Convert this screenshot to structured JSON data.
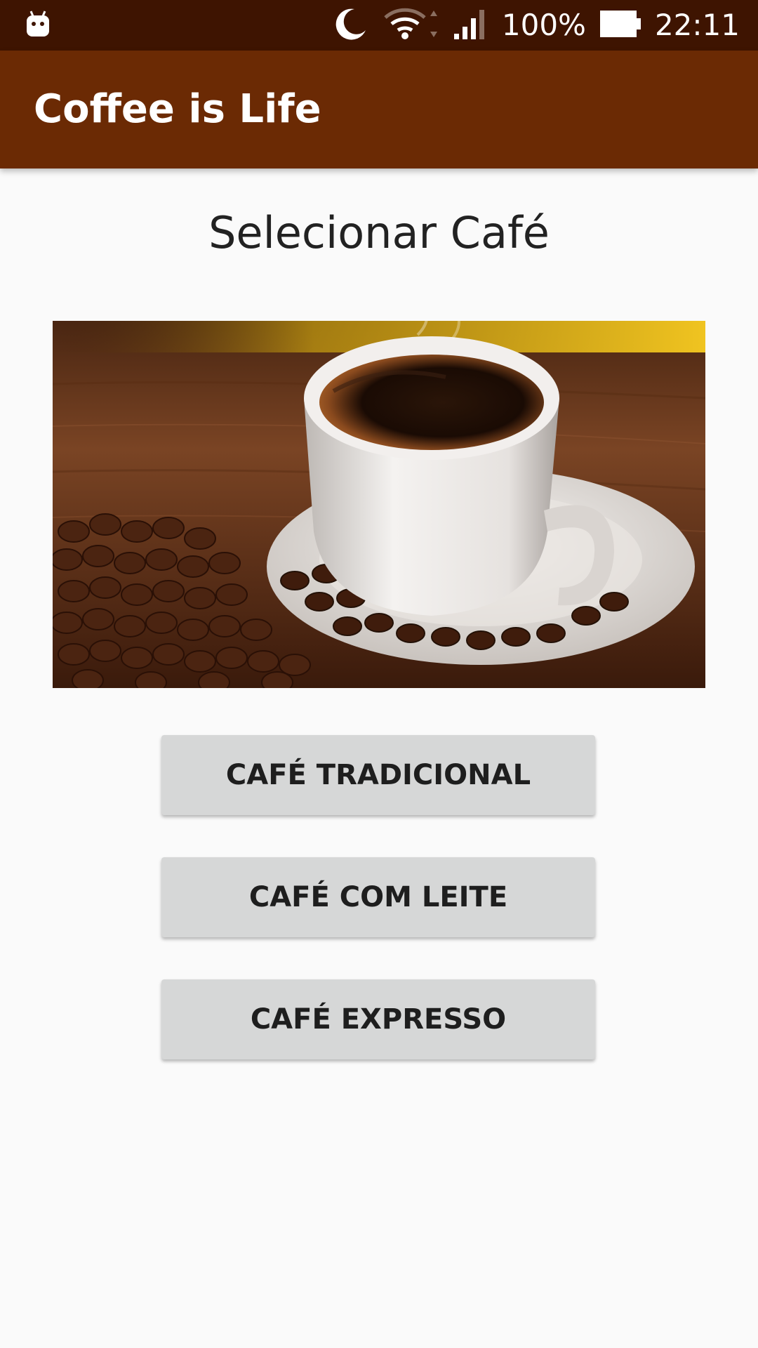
{
  "status_bar": {
    "battery": "100%",
    "time": "22:11",
    "icons": [
      "android-icon",
      "moon-icon",
      "wifi-icon",
      "signal-icon",
      "battery-icon"
    ]
  },
  "app_bar": {
    "title": "Coffee is Life",
    "color": "#6b2a04"
  },
  "main": {
    "heading": "Selecionar Café",
    "hero_image": "coffee-cup-with-beans",
    "buttons": [
      {
        "label": "CAFÉ TRADICIONAL"
      },
      {
        "label": "CAFÉ COM LEITE"
      },
      {
        "label": "CAFÉ EXPRESSO"
      }
    ]
  },
  "colors": {
    "status_bar": "#3e1401",
    "app_bar": "#6b2a04",
    "button_bg": "#d6d7d7",
    "background": "#fafafa"
  }
}
